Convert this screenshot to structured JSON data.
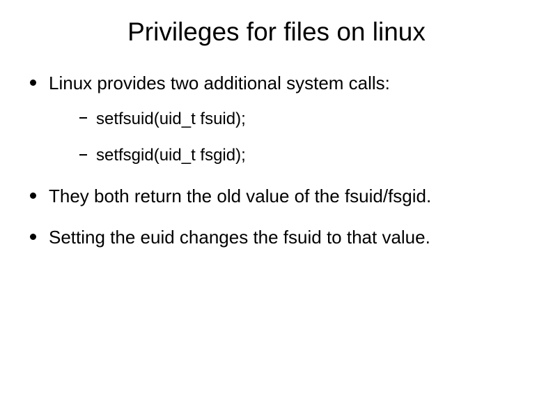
{
  "title": "Privileges for files on linux",
  "bullets": {
    "b0": {
      "text": "Linux provides two additional system calls:",
      "subs": {
        "s0": "setfsuid(uid_t fsuid);",
        "s1": "setfsgid(uid_t fsgid);"
      }
    },
    "b1": {
      "text": "They both return the old value of the fsuid/fsgid."
    },
    "b2": {
      "text": "Setting the euid changes the fsuid to that value."
    }
  }
}
